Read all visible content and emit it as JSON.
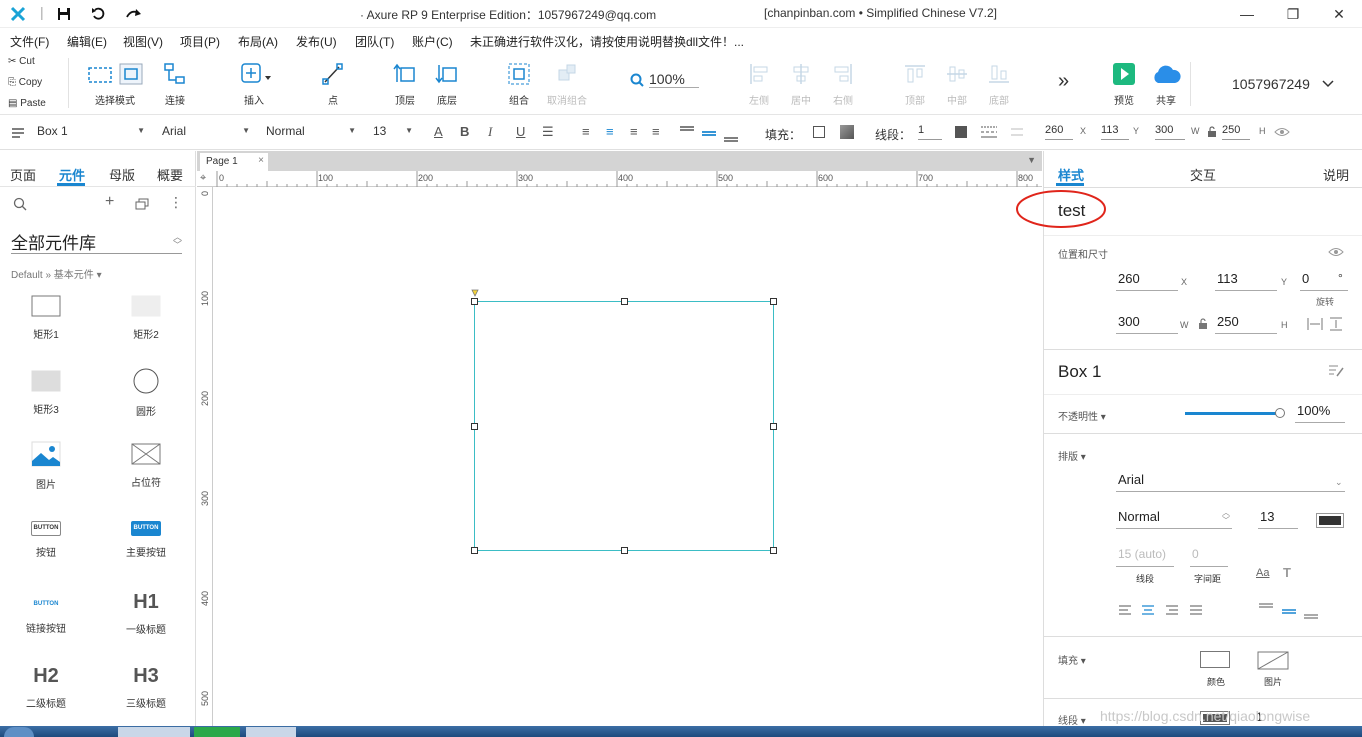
{
  "titlebar": {
    "title": "·  Axure RP 9 Enterprise Edition：1057967249@qq.com",
    "title_suffix": "[chanpinban.com • Simplified Chinese V7.2]",
    "minimize": "—",
    "restore": "❐",
    "close": "✕"
  },
  "menu": {
    "items": [
      "文件(F)",
      "编辑(E)",
      "视图(V)",
      "项目(P)",
      "布局(A)",
      "发布(U)",
      "团队(T)",
      "账户(C)",
      "未正确进行软件汉化，请按使用说明替换dll文件！..."
    ]
  },
  "toolbar": {
    "cut": "Cut",
    "copy": "Copy",
    "paste": "Paste",
    "select_mode": "选择模式",
    "connect": "连接",
    "insert": "插入",
    "point": "点",
    "top_layer": "顶层",
    "bottom_layer": "底层",
    "group": "组合",
    "ungroup": "取消组合",
    "zoom": "100%",
    "align_left": "左侧",
    "align_center": "居中",
    "align_right": "右侧",
    "align_top": "顶部",
    "align_middle": "中部",
    "align_bottom": "底部",
    "more": "»",
    "preview": "预览",
    "share": "共享",
    "account": "1057967249"
  },
  "formatbar": {
    "widget_name": "Box 1",
    "font": "Arial",
    "style": "Normal",
    "size": "13",
    "fill_label": "填充：",
    "stroke_label": "线段：",
    "stroke_width": "1",
    "x": "260",
    "y": "113",
    "w": "300",
    "h": "250",
    "x_lbl": "X",
    "y_lbl": "Y",
    "w_lbl": "W",
    "h_lbl": "H"
  },
  "leftpanel": {
    "tabs": [
      "页面",
      "元件",
      "母版",
      "概要"
    ],
    "active_tab": "元件",
    "library_title": "全部元件库",
    "breadcrumb": "Default » 基本元件 ▾",
    "widgets": [
      {
        "label": "矩形1"
      },
      {
        "label": "矩形2"
      },
      {
        "label": "矩形3"
      },
      {
        "label": "圆形"
      },
      {
        "label": "图片"
      },
      {
        "label": "占位符"
      },
      {
        "label": "按钮",
        "glyph": "BUTTON"
      },
      {
        "label": "主要按钮",
        "glyph": "BUTTON"
      },
      {
        "label": "链接按钮",
        "glyph": "BUTTON"
      },
      {
        "label": "一级标题",
        "glyph": "H1"
      },
      {
        "label": "二级标题",
        "glyph": "H2"
      },
      {
        "label": "三级标题",
        "glyph": "H3"
      }
    ]
  },
  "canvas": {
    "page_tab": "Page 1",
    "hruler": [
      "0",
      "100",
      "200",
      "300",
      "400",
      "500",
      "600",
      "700",
      "800"
    ],
    "vruler": [
      "0",
      "100",
      "200",
      "300",
      "400",
      "500"
    ]
  },
  "rightpanel": {
    "tabs": [
      "样式",
      "交互",
      "说明"
    ],
    "active_tab": "样式",
    "style_name": "test",
    "pos_size_label": "位置和尺寸",
    "x": "260",
    "y": "113",
    "rotation": "0",
    "x_lbl": "X",
    "y_lbl": "Y",
    "rot_unit": "°",
    "rot_lbl": "旋转",
    "w": "300",
    "h": "250",
    "w_lbl": "W",
    "h_lbl": "H",
    "widget_name": "Box 1",
    "opacity_label": "不透明性 ▾",
    "opacity": "100%",
    "opacity_level": 1.0,
    "typography_label": "排版 ▾",
    "font": "Arial",
    "font_style": "Normal",
    "font_size": "13",
    "line_spacing": "15 (auto)",
    "char_spacing": "0",
    "line_spacing_lbl": "线段",
    "char_spacing_lbl": "字间距",
    "fill_label": "填充 ▾",
    "fill_color_lbl": "颜色",
    "fill_image_lbl": "图片",
    "stroke_label": "线段 ▾",
    "stroke_width": "1"
  },
  "watermark": "https://blog.csdn.net/qiaolongwise",
  "colors": {
    "accent": "#1a86d0",
    "selection": "#3bbdc5",
    "annotation": "#e0251b",
    "preview_green": "#1db97f",
    "share_blue": "#2a8ee8"
  }
}
